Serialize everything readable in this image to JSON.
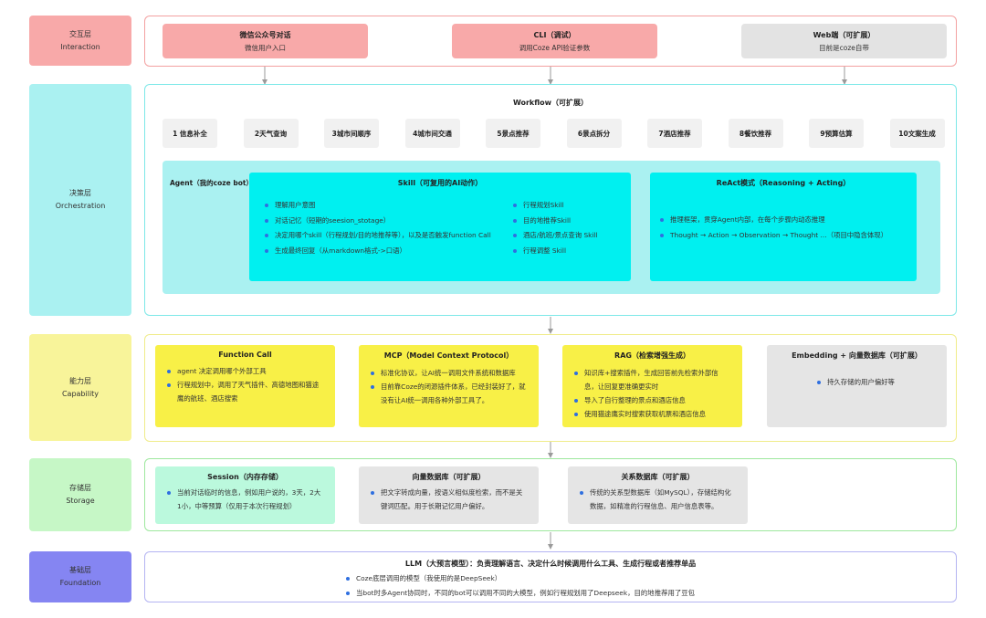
{
  "colors": {
    "interaction": "#f8a9a9",
    "orchestration": "#aaf1f1",
    "capability": "#f8f49a",
    "storage": "#c6f7c6",
    "foundation": "#8585f2",
    "cyan": "#00f0f0",
    "yellow": "#f8f047",
    "gray": "#e5e5e5",
    "mint": "#bbf9dd",
    "bullet": "#2f6fe0"
  },
  "layers": {
    "interaction": {
      "name": "交互层",
      "en": "Interaction"
    },
    "orchestration": {
      "name": "决策层",
      "en": "Orchestration"
    },
    "capability": {
      "name": "能力层",
      "en": "Capability"
    },
    "storage": {
      "name": "存储层",
      "en": "Storage"
    },
    "foundation": {
      "name": "基础层",
      "en": "Foundation"
    }
  },
  "interaction": {
    "wechat": {
      "title": "微信公众号对话",
      "sub": "微信用户入口"
    },
    "cli": {
      "title": "CLI（调试）",
      "sub": "调用Coze API验证参数"
    },
    "web": {
      "title": "Web端（可扩展）",
      "sub": "目前是coze自带"
    }
  },
  "workflow": {
    "title": "Workflow（可扩展）",
    "steps": [
      "1 信息补全",
      "2天气查询",
      "3城市间顺序",
      "4城市间交通",
      "5景点推荐",
      "6景点拆分",
      "7酒店推荐",
      "8餐饮推荐",
      "9预算估算",
      "10文案生成"
    ]
  },
  "agent": {
    "label": "Agent（我的coze bot）",
    "skill": {
      "title": "Skill（可复用的AI动作）",
      "left": [
        "理解用户意图",
        "对话记忆（短期的seesion_stotage）",
        "决定用哪个skill（行程规划/目的地推荐等），以及是否触发function Call",
        "生成最终回复（从markdown格式->口语）"
      ],
      "right": [
        "行程规划Skill",
        "目的地推荐Skill",
        "酒店/航班/景点查询 Skill",
        "行程调整 Skill"
      ]
    },
    "react": {
      "title": "ReAct模式（Reasoning + Acting）",
      "items": [
        "推理框架，贯穿Agent内部，在每个步骤内动态推理",
        "Thought → Action → Observation → Thought ...（项目中隐含体现）"
      ]
    }
  },
  "capability": {
    "function_call": {
      "title": "Function Call",
      "items": [
        "agent 决定调用哪个外部工具",
        "行程规划中，调用了天气插件、高德地图和猫途鹰的航班、酒店搜索"
      ]
    },
    "mcp": {
      "title": "MCP（Model Context Protocol）",
      "items": [
        "标准化协议，让AI统一调用文件系统和数据库",
        "目前靠Coze的闭源插件体系，已经封装好了，就没有让AI统一调用各种外部工具了。"
      ]
    },
    "rag": {
      "title": "RAG（检索增强生成）",
      "items": [
        "知识库+搜索插件，生成回答前先检索外部信息，让回复更准确更实时",
        "导入了自行整理的景点和酒店信息",
        "使用猫途鹰实时搜索获取机票和酒店信息"
      ]
    },
    "embedding": {
      "title": "Embedding + 向量数据库（可扩展）",
      "items": [
        "持久存储的用户偏好等"
      ]
    }
  },
  "storage": {
    "session": {
      "title": "Session（内存存储）",
      "items": [
        "当前对话临时的信息，例如用户说的，3天，2大1小，中等预算（仅用于本次行程规划）"
      ]
    },
    "vector": {
      "title": "向量数据库（可扩展）",
      "items": [
        "把文字转成向量，按语义相似度检索，而不是关键词匹配。用于长期记忆用户偏好。"
      ]
    },
    "relational": {
      "title": "关系数据库（可扩展）",
      "items": [
        "传统的关系型数据库（如MySQL），存储结构化数据，如精准的行程信息、用户信息表等。"
      ]
    }
  },
  "foundation": {
    "title": "LLM（大预言模型）：负责理解语言、决定什么时候调用什么工具、生成行程或者推荐单品",
    "items": [
      "Coze底层调用的模型（我使用的是DeepSeek）",
      "当bot时多Agent协同时，不同的bot可以调用不同的大模型，例如行程规划用了Deepseek，目的地推荐用了豆包"
    ]
  }
}
